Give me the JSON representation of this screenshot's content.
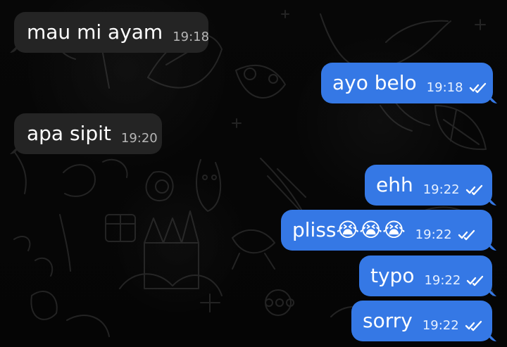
{
  "chat": {
    "messages": [
      {
        "direction": "incoming",
        "text": "mau mi ayam",
        "time": "19:18",
        "status_icon": ""
      },
      {
        "direction": "outgoing",
        "text": "ayo belo",
        "time": "19:18",
        "status_icon": "double-check-icon"
      },
      {
        "direction": "incoming",
        "text": "apa sipit",
        "time": "19:20",
        "status_icon": ""
      },
      {
        "direction": "outgoing",
        "text": "ehh",
        "time": "19:22",
        "status_icon": "double-check-icon"
      },
      {
        "direction": "outgoing",
        "text": "pliss😭😭😭",
        "time": "19:22",
        "status_icon": "double-check-icon"
      },
      {
        "direction": "outgoing",
        "text": "typo",
        "time": "19:22",
        "status_icon": "double-check-icon"
      },
      {
        "direction": "outgoing",
        "text": "sorry",
        "time": "19:22",
        "status_icon": "double-check-icon"
      }
    ]
  },
  "theme": {
    "background": "#070707",
    "incoming_bubble": "#242424",
    "outgoing_bubble": "#3578e5",
    "text": "#ffffff"
  }
}
